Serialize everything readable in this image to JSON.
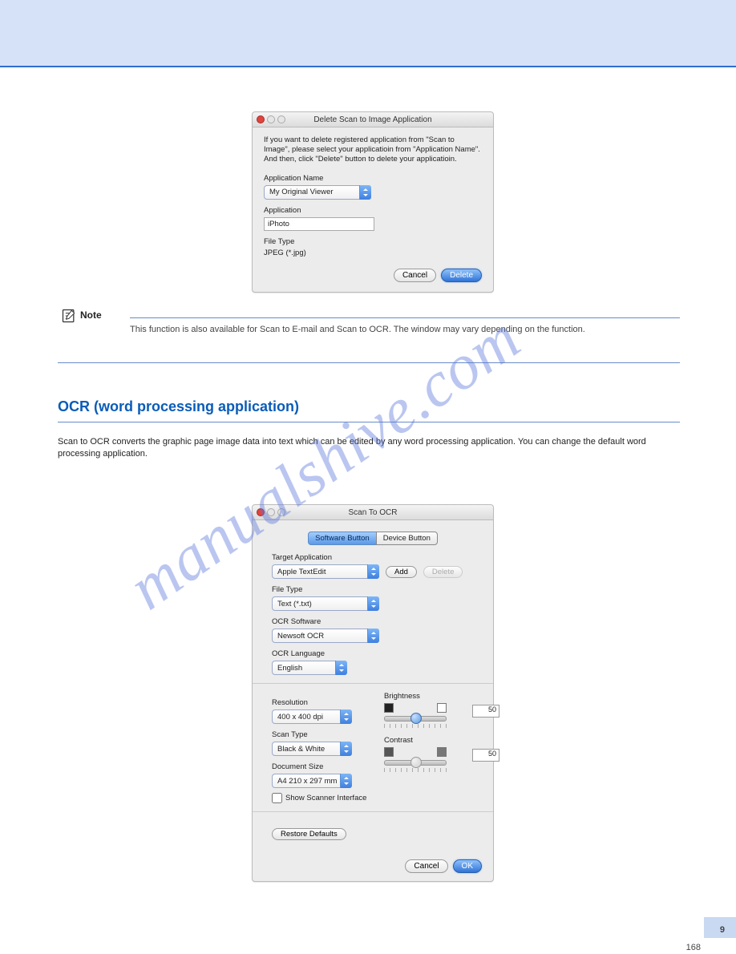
{
  "page": {
    "number": "168",
    "sidebar_number": "9"
  },
  "dialog1": {
    "title": "Delete Scan to Image Application",
    "instruction": "If you want to delete registered application from \"Scan to Image\", please select your applicatioin from \"Application Name\".\nAnd then, click \"Delete\" button to delete your applicatioin.",
    "appname_label": "Application Name",
    "appname_value": "My Original Viewer",
    "application_label": "Application",
    "application_value": "iPhoto",
    "filetype_label": "File Type",
    "filetype_value": "JPEG (*.jpg)",
    "cancel": "Cancel",
    "delete": "Delete"
  },
  "note": {
    "label": "Note",
    "text": "This function is also available for Scan to E-mail and Scan to OCR. The window may vary depending on the function."
  },
  "section": {
    "title": "OCR (word processing application)",
    "paragraph": "Scan to OCR converts the graphic page image data into text which can be edited by any word processing application. You can change the default word processing application."
  },
  "dialog2": {
    "title": "Scan To OCR",
    "tabs": {
      "software": "Software Button",
      "device": "Device Button"
    },
    "target_label": "Target Application",
    "target_value": "Apple TextEdit",
    "add": "Add",
    "delete": "Delete",
    "filetype_label": "File Type",
    "filetype_value": "Text (*.txt)",
    "ocrsw_label": "OCR Software",
    "ocrsw_value": "Newsoft OCR",
    "ocrlang_label": "OCR Language",
    "ocrlang_value": "English",
    "resolution_label": "Resolution",
    "resolution_value": "400 x 400 dpi",
    "scantype_label": "Scan Type",
    "scantype_value": "Black & White",
    "docsize_label": "Document Size",
    "docsize_value": "A4  210 x 297 mm",
    "show_scanner": "Show Scanner Interface",
    "brightness_label": "Brightness",
    "brightness_value": "50",
    "contrast_label": "Contrast",
    "contrast_value": "50",
    "restore": "Restore Defaults",
    "cancel": "Cancel",
    "ok": "OK"
  },
  "watermark": "manualshive.com"
}
